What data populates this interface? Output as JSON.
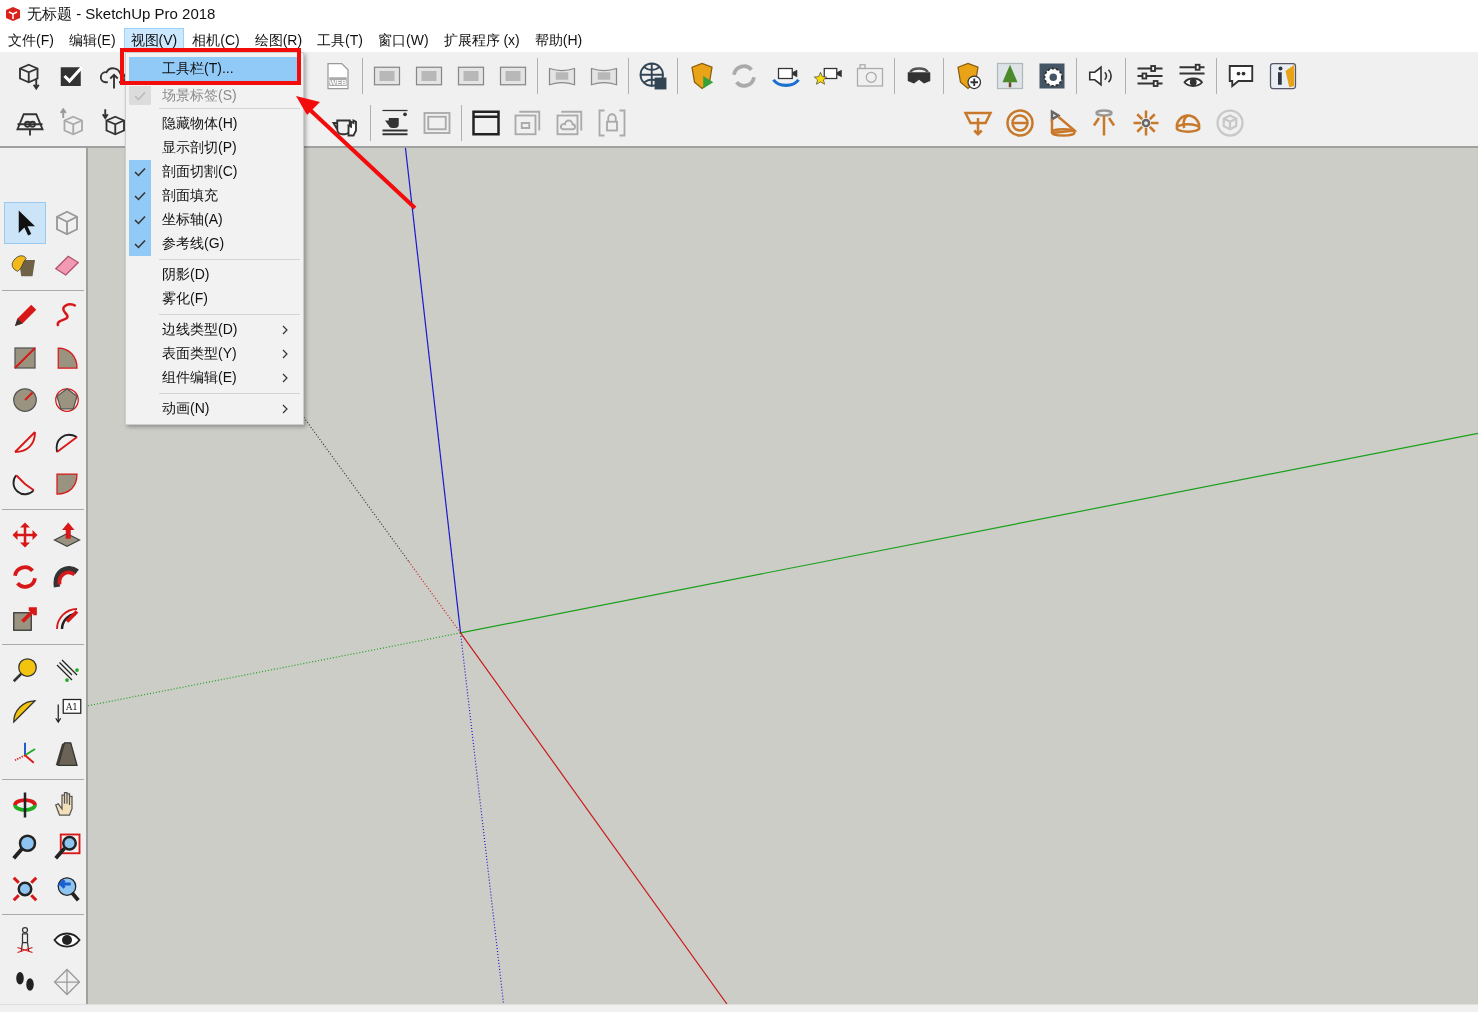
{
  "window": {
    "title": "无标题 - SketchUp Pro 2018"
  },
  "menu_bar": [
    {
      "label": "文件(F)",
      "selected": false
    },
    {
      "label": "编辑(E)",
      "selected": false
    },
    {
      "label": "视图(V)",
      "selected": true
    },
    {
      "label": "相机(C)",
      "selected": false
    },
    {
      "label": "绘图(R)",
      "selected": false
    },
    {
      "label": "工具(T)",
      "selected": false
    },
    {
      "label": "窗口(W)",
      "selected": false
    },
    {
      "label": "扩展程序 (x)",
      "selected": false
    },
    {
      "label": "帮助(H)",
      "selected": false
    }
  ],
  "view_menu": {
    "items": [
      {
        "kind": "item",
        "label": "工具栏(T)...",
        "selected": true,
        "checked": false,
        "disabled": false,
        "submenu": false
      },
      {
        "kind": "item",
        "label": "场景标签(S)",
        "selected": false,
        "checked": true,
        "disabled": true,
        "submenu": false
      },
      {
        "kind": "separator"
      },
      {
        "kind": "item",
        "label": "隐藏物体(H)",
        "selected": false,
        "checked": false,
        "disabled": false,
        "submenu": false
      },
      {
        "kind": "item",
        "label": "显示剖切(P)",
        "selected": false,
        "checked": false,
        "disabled": false,
        "submenu": false
      },
      {
        "kind": "item",
        "label": "剖面切割(C)",
        "selected": false,
        "checked": true,
        "disabled": false,
        "submenu": false
      },
      {
        "kind": "item",
        "label": "剖面填充",
        "selected": false,
        "checked": true,
        "disabled": false,
        "submenu": false
      },
      {
        "kind": "item",
        "label": "坐标轴(A)",
        "selected": false,
        "checked": true,
        "disabled": false,
        "submenu": false
      },
      {
        "kind": "item",
        "label": "参考线(G)",
        "selected": false,
        "checked": true,
        "disabled": false,
        "submenu": false
      },
      {
        "kind": "separator"
      },
      {
        "kind": "item",
        "label": "阴影(D)",
        "selected": false,
        "checked": false,
        "disabled": false,
        "submenu": false
      },
      {
        "kind": "item",
        "label": "雾化(F)",
        "selected": false,
        "checked": false,
        "disabled": false,
        "submenu": false
      },
      {
        "kind": "separator"
      },
      {
        "kind": "item",
        "label": "边线类型(D)",
        "selected": false,
        "checked": false,
        "disabled": false,
        "submenu": true
      },
      {
        "kind": "item",
        "label": "表面类型(Y)",
        "selected": false,
        "checked": false,
        "disabled": false,
        "submenu": true
      },
      {
        "kind": "item",
        "label": "组件编辑(E)",
        "selected": false,
        "checked": false,
        "disabled": false,
        "submenu": true
      },
      {
        "kind": "separator"
      },
      {
        "kind": "item",
        "label": "动画(N)",
        "selected": false,
        "checked": false,
        "disabled": false,
        "submenu": true
      }
    ]
  },
  "toolbar": {
    "web_badge": "WEB"
  },
  "left_toolbar": {
    "text_tool_label": "A1",
    "tools": [
      {
        "selected": true
      },
      {
        "selected": false
      },
      {
        "selected": false
      },
      {
        "selected": false
      },
      {
        "selected": false
      },
      {
        "selected": false
      },
      {
        "selected": false
      },
      {
        "selected": false
      },
      {
        "selected": false
      },
      {
        "selected": false
      },
      {
        "selected": false
      },
      {
        "selected": false
      },
      {
        "selected": false
      },
      {
        "selected": false
      },
      {
        "selected": false
      },
      {
        "selected": false
      },
      {
        "selected": false
      },
      {
        "selected": false
      },
      {
        "selected": false
      },
      {
        "selected": false
      },
      {
        "selected": false
      },
      {
        "selected": false
      },
      {
        "selected": false
      },
      {
        "selected": false
      },
      {
        "selected": false
      },
      {
        "selected": false
      },
      {
        "selected": false
      },
      {
        "selected": false
      },
      {
        "selected": false
      },
      {
        "selected": false
      },
      {
        "selected": false
      },
      {
        "selected": false
      },
      {
        "selected": false
      },
      {
        "selected": false
      },
      {
        "selected": false
      },
      {
        "selected": false
      }
    ]
  }
}
